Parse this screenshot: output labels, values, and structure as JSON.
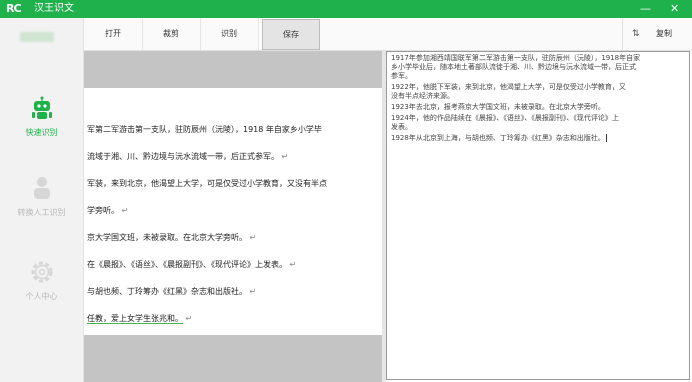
{
  "app": {
    "logo": "RC",
    "title": "汉王识文",
    "minimize": "—",
    "close": "✕"
  },
  "sidebar": {
    "items": [
      {
        "label": "快速识别",
        "icon": "robot-icon",
        "color": "#1fb14b",
        "active": true
      },
      {
        "label": "转换人工识别",
        "icon": "person-icon",
        "active": false
      },
      {
        "label": "个人中心",
        "icon": "gear-icon",
        "active": false
      }
    ]
  },
  "toolbar": {
    "open": "打开",
    "crop": "裁剪",
    "recognize": "识别",
    "save": "保存",
    "copy_icon": "⇅",
    "copy": "复制"
  },
  "document": {
    "lines": [
      "军第二军游击第一支队，驻防辰州（沅陵），1918 年自家乡小学毕",
      "流域于湘、川、黔边境与沅水流域一带，后正式参军。",
      "军装，来到北京，他渴望上大学，可是仅受过小学教育，又没有半点",
      "学旁听。",
      "京大学国文班，未被录取。在北京大学旁听。",
      "在《晨报》、《语丝》、《晨报副刊》、《现代评论》上发表。",
      "与胡也频、丁玲筹办《红黑》杂志和出版社。",
      "任教，爱上女学生张兆和。"
    ],
    "return_mark": "↵"
  },
  "ocr": {
    "lines": [
      "1917年参加湘西靖国联军第二军游击第一支队，驻防辰州（沅陵），1918年自家",
      "乡小学毕业后，随本地土著部队流徙于湘、川、黔边境与沅水流域一带，后正式",
      "参军。",
      "1922年，他脱下军装，来到北京，他渴望上大学，可是仅受过小学教育，又",
      "没有半点经济来源。",
      "1923年去北京，报考燕京大学国文班，未被录取。在北京大学旁听。",
      "1924年，他的作品陆续在《晨报》、《语丝》、《晨报副刊》、《现代评论》上",
      "发表。",
      "1928年从北京到上海，与胡也频、丁玲筹办《红黑》杂志和出版社。"
    ]
  }
}
